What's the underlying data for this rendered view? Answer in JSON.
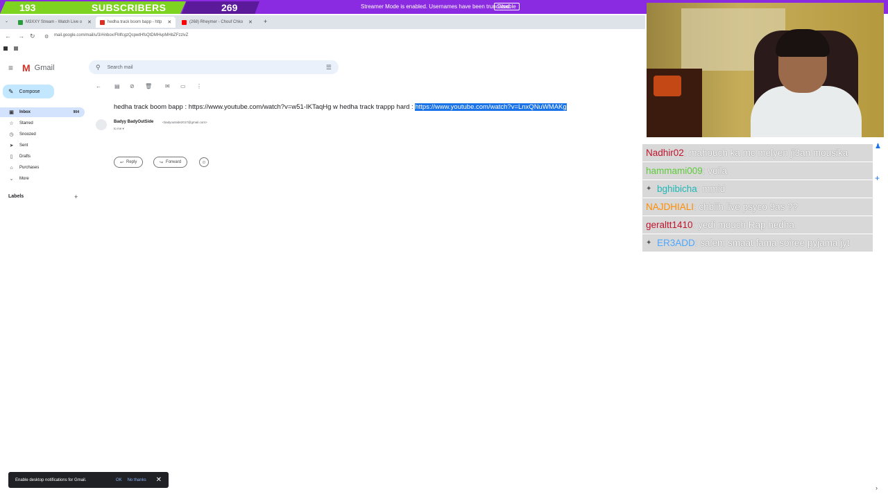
{
  "overlay": {
    "subscribers_current": "193",
    "subscribers_label": "SUBSCRIBERS",
    "subscribers_goal": "269",
    "streamer_mode_text": "Streamer Mode is enabled. Usernames have been truncated.",
    "disable_label": "Disable"
  },
  "browser": {
    "tabs": [
      {
        "label": "M3XXY Stream - Watch Live o",
        "color": "#2a9d3a"
      },
      {
        "label": "hedha track boom bapp - http",
        "color": "#d93025"
      },
      {
        "label": "(268) Rheymer - Chouf Chko",
        "color": "#ff0000"
      }
    ],
    "url": "mail.google.com/mail/u/3/#inbox/FMfcgzQcpwtHfsQtDMHvpMHbZFzzlvZ"
  },
  "gmail": {
    "logo_text": "Gmail",
    "search_placeholder": "Search mail",
    "compose_label": "Compose",
    "nav": [
      {
        "label": "Inbox",
        "count": "904",
        "icon": "inbox-icon"
      },
      {
        "label": "Starred",
        "count": "",
        "icon": "star-icon"
      },
      {
        "label": "Snoozed",
        "count": "",
        "icon": "clock-icon"
      },
      {
        "label": "Sent",
        "count": "",
        "icon": "send-icon"
      },
      {
        "label": "Drafts",
        "count": "",
        "icon": "draft-icon"
      },
      {
        "label": "Purchases",
        "count": "",
        "icon": "tag-icon"
      },
      {
        "label": "More",
        "count": "",
        "icon": "chevron-down-icon"
      }
    ],
    "labels_heading": "Labels",
    "email": {
      "subject_plain": "hedha track boom bapp : https://www.youtube.com/watch?v=w51-IKTaqHg w hedha track trappp hard :",
      "subject_selected": "https://www.youtube.com/watch?v=LnxQNuWMAKg",
      "sender_name": "Badyy BadyOutSide",
      "sender_email": "<badyoutside2017@gmail.com>",
      "to_me": "to me ▾",
      "reply_label": "Reply",
      "forward_label": "Forward"
    },
    "toast": {
      "message": "Enable desktop notifications for Gmail.",
      "ok_label": "OK",
      "no_label": "No thanks"
    }
  },
  "chat": [
    {
      "user": "Nadhir02",
      "user_color": "#c0142c",
      "message": ": mahouch ka mc melyen ji3an mousika",
      "badge": false
    },
    {
      "user": "hammami009",
      "user_color": "#5ec93a",
      "message": ": voila",
      "badge": false
    },
    {
      "user": "bghibicha",
      "user_color": "#1fb5b5",
      "message": ": mmid",
      "badge": true
    },
    {
      "user": "NAJDHIALI",
      "user_color": "#ff8c00",
      "message": ": chbiih live psyco 9as ??",
      "badge": false
    },
    {
      "user": "geraltt1410",
      "user_color": "#c0142c",
      "message": ": yedi mouch Rap hedha",
      "badge": false
    },
    {
      "user": "ER3ADD",
      "user_color": "#4da6ff",
      "message": ": salem smaat fama soiree pyjama jyt",
      "badge": true
    }
  ]
}
